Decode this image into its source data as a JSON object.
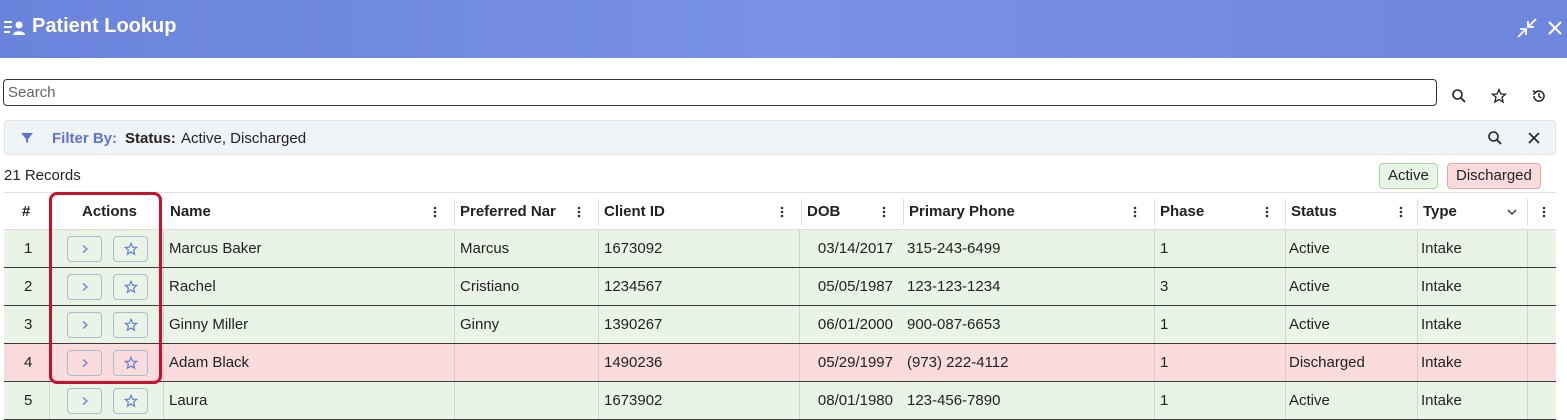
{
  "window": {
    "title": "Patient Lookup"
  },
  "search": {
    "placeholder": "Search"
  },
  "filter": {
    "label": "Filter By:",
    "key": "Status:",
    "value": "Active, Discharged"
  },
  "records": {
    "count_text": "21 Records"
  },
  "legend": {
    "active": "Active",
    "discharged": "Discharged"
  },
  "colors": {
    "header": "#7189e0",
    "accent": "#5b74d6",
    "active_row": "#e9f4e6",
    "discharged_row": "#fadcdd",
    "highlight": "#c8102e"
  },
  "table": {
    "columns": [
      "#",
      "Actions",
      "Name",
      "Preferred Nar",
      "Client ID",
      "DOB",
      "Primary Phone",
      "Phase",
      "Status",
      "Type"
    ],
    "rows": [
      {
        "num": "1",
        "name": "Marcus Baker",
        "preferred": "Marcus",
        "client_id": "1673092",
        "dob": "03/14/2017",
        "phone": "315-243-6499",
        "phase": "1",
        "status": "Active",
        "type": "Intake"
      },
      {
        "num": "2",
        "name": "Rachel",
        "preferred": "Cristiano",
        "client_id": "1234567",
        "dob": "05/05/1987",
        "phone": "123-123-1234",
        "phase": "3",
        "status": "Active",
        "type": "Intake"
      },
      {
        "num": "3",
        "name": "Ginny Miller",
        "preferred": "Ginny",
        "client_id": "1390267",
        "dob": "06/01/2000",
        "phone": "900-087-6653",
        "phase": "1",
        "status": "Active",
        "type": "Intake"
      },
      {
        "num": "4",
        "name": "Adam Black",
        "preferred": "",
        "client_id": "1490236",
        "dob": "05/29/1997",
        "phone": "(973) 222-4112",
        "phase": "1",
        "status": "Discharged",
        "type": "Intake"
      },
      {
        "num": "5",
        "name": "Laura",
        "preferred": "",
        "client_id": "1673902",
        "dob": "08/01/1980",
        "phone": "123-456-7890",
        "phase": "1",
        "status": "Active",
        "type": "Intake"
      }
    ]
  }
}
